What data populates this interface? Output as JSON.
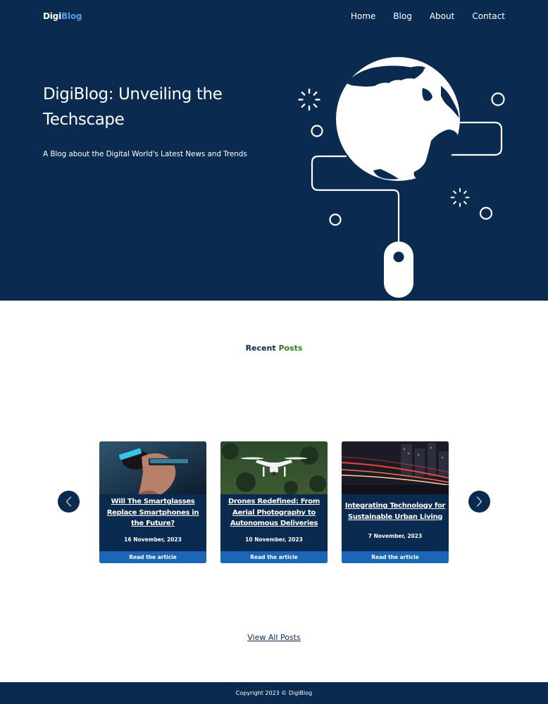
{
  "header": {
    "logo_primary": "Digi",
    "logo_accent": "Blog",
    "nav": [
      "Home",
      "Blog",
      "About",
      "Contact"
    ]
  },
  "hero": {
    "title": "DigiBlog: Unveiling the Techscape",
    "subtitle": "A Blog about the Digital World's Latest News and Trends"
  },
  "recent": {
    "title_primary": "Recent",
    "title_accent": "Posts",
    "cards": [
      {
        "title": "Will The Smartglasses Replace Smartphones in the Future?",
        "date": "16 November, 2023",
        "cta": "Read the article"
      },
      {
        "title": "Drones Redefined: From Aerial Photography to Autonomous Deliveries",
        "date": "10 November, 2023",
        "cta": "Read the article"
      },
      {
        "title": "Integrating Technology for Sustainable Urban Living",
        "date": "7 November, 2023",
        "cta": "Read the article"
      }
    ],
    "view_all": "View All Posts"
  },
  "footer": {
    "copyright": "Copyright 2023 © DigiBlog"
  },
  "colors": {
    "navy": "#0b2a4f",
    "accent_blue": "#4f9de8",
    "button_blue": "#1c66b8",
    "accent_green": "#2e7d1f"
  }
}
